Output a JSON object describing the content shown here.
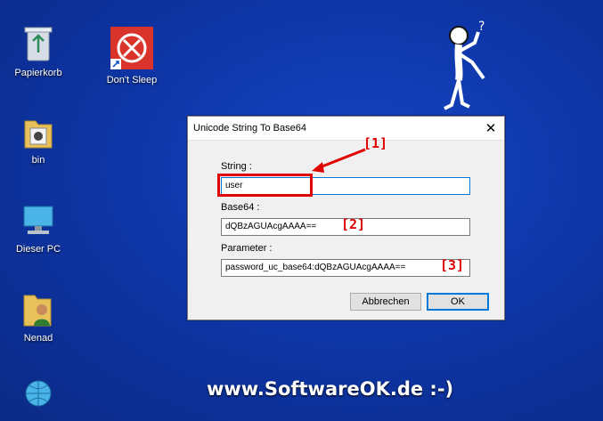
{
  "desktop": {
    "icons": [
      {
        "label": "Papierkorb",
        "icon": "recycle-bin-icon"
      },
      {
        "label": "Don't Sleep",
        "icon": "dont-sleep-icon"
      },
      {
        "label": "bin",
        "icon": "folder-icon"
      },
      {
        "label": "Dieser PC",
        "icon": "computer-icon"
      },
      {
        "label": "Nenad",
        "icon": "user-folder-icon"
      },
      {
        "label": "",
        "icon": "network-icon"
      }
    ],
    "footer": "www.SoftwareOK.de :-)",
    "accent_color": "#0e36a8"
  },
  "dialog": {
    "title": "Unicode String To Base64",
    "close_symbol": "✕",
    "string_label": "String :",
    "string_value": "user",
    "base64_label": "Base64 :",
    "base64_value": "dQBzAGUAcgAAAA==",
    "parameter_label": "Parameter :",
    "parameter_value": "password_uc_base64:dQBzAGUAcgAAAA==",
    "cancel_label": "Abbrechen",
    "ok_label": "OK"
  },
  "annotations": {
    "a1": "[1]",
    "a2": "[2]",
    "a3": "[3]",
    "color": "#e00000"
  }
}
